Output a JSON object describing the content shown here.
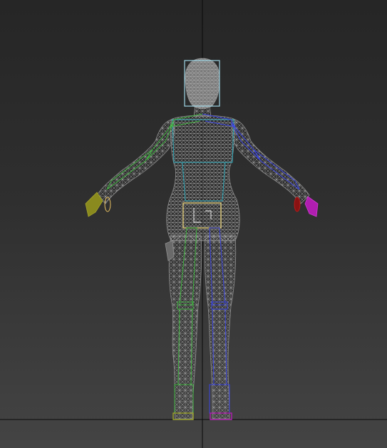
{
  "viewport": {
    "view": "front",
    "shading": "wireframe",
    "background_top": "#262626",
    "background_bottom": "#444444",
    "grid_axis_color": "#0a0a0a"
  },
  "model": {
    "mesh_color": "#9a9a9a",
    "head_bone_color": "#9fd6e6",
    "spine_bone_color": "#2aa7b8",
    "pelvis_bone_color": "#e8d27a",
    "left_side_color": "#3fb43f",
    "right_side_color": "#3a44e0",
    "left_hand_color": "#8a8a1e",
    "right_hand_color": "#b01eb0",
    "left_finger_color": "#e8c060",
    "right_finger_color": "#b81a1a"
  }
}
